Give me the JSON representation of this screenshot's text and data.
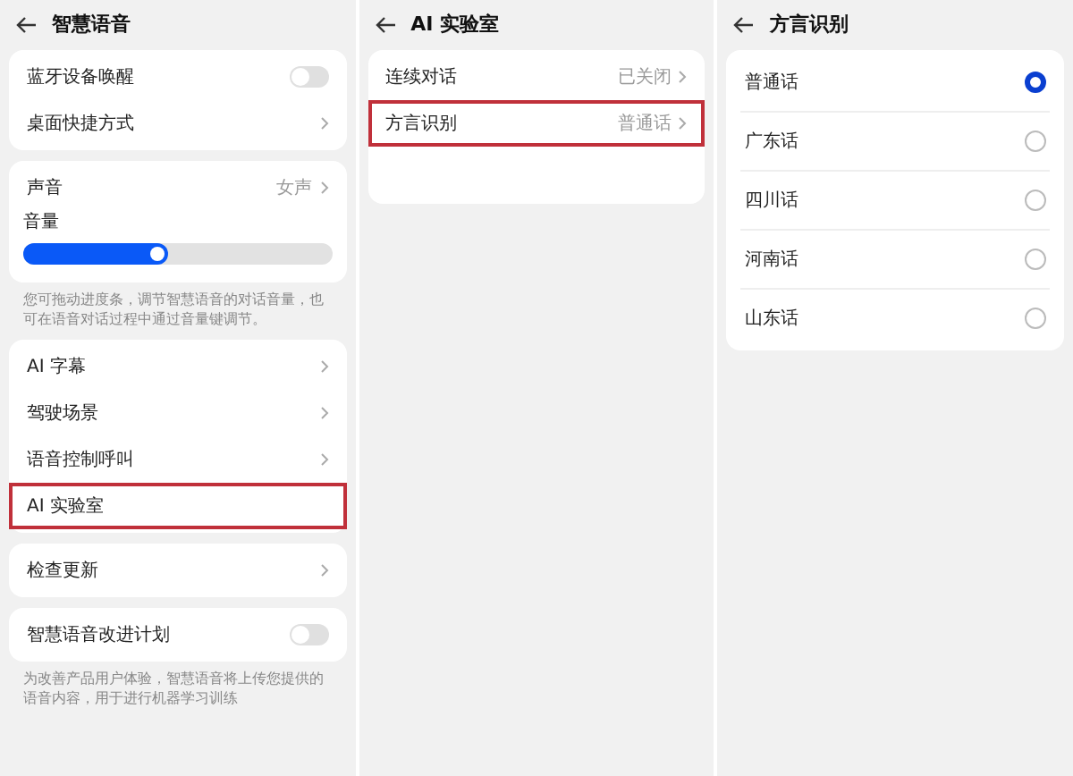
{
  "screens": [
    {
      "title": "智慧语音",
      "sections": [
        {
          "items": [
            {
              "kind": "toggle",
              "label": "蓝牙设备唤醒",
              "on": false,
              "highlighted": false
            },
            {
              "kind": "link",
              "label": "桌面快捷方式",
              "highlighted": false
            }
          ]
        },
        {
          "items": [
            {
              "kind": "link",
              "label": "声音",
              "value": "女声",
              "highlighted": false
            },
            {
              "kind": "slider",
              "label": "音量",
              "level": 0.47,
              "highlighted": false
            }
          ],
          "note": "您可拖动进度条，调节智慧语音的对话音量，也可在语音对话过程中通过音量键调节。"
        },
        {
          "items": [
            {
              "kind": "link",
              "label": "AI 字幕",
              "highlighted": false
            },
            {
              "kind": "link",
              "label": "驾驶场景",
              "highlighted": false
            },
            {
              "kind": "link",
              "label": "语音控制呼叫",
              "highlighted": false
            },
            {
              "kind": "plain",
              "label": "AI 实验室",
              "highlighted": true
            }
          ]
        },
        {
          "items": [
            {
              "kind": "link",
              "label": "检查更新",
              "highlighted": false
            }
          ]
        },
        {
          "items": [
            {
              "kind": "toggle",
              "label": "智慧语音改进计划",
              "on": false,
              "highlighted": false
            }
          ],
          "note": "为改善产品用户体验，智慧语音将上传您提供的语音内容，用于进行机器学习训练"
        }
      ]
    },
    {
      "title": "AI 实验室",
      "sections": [
        {
          "items": [
            {
              "kind": "link",
              "label": "连续对话",
              "value": "已关闭",
              "highlighted": false
            },
            {
              "kind": "link",
              "label": "方言识别",
              "value": "普通话",
              "highlighted": true
            }
          ],
          "tall": true
        }
      ]
    },
    {
      "title": "方言识别",
      "sections": [
        {
          "items": [
            {
              "kind": "radio",
              "label": "普通话",
              "selected": true,
              "highlighted": false
            },
            {
              "kind": "radio",
              "label": "广东话",
              "selected": false,
              "highlighted": false
            },
            {
              "kind": "radio",
              "label": "四川话",
              "selected": false,
              "highlighted": false
            },
            {
              "kind": "radio",
              "label": "河南话",
              "selected": false,
              "highlighted": false
            },
            {
              "kind": "radio",
              "label": "山东话",
              "selected": false,
              "highlighted": false
            }
          ]
        }
      ]
    }
  ]
}
